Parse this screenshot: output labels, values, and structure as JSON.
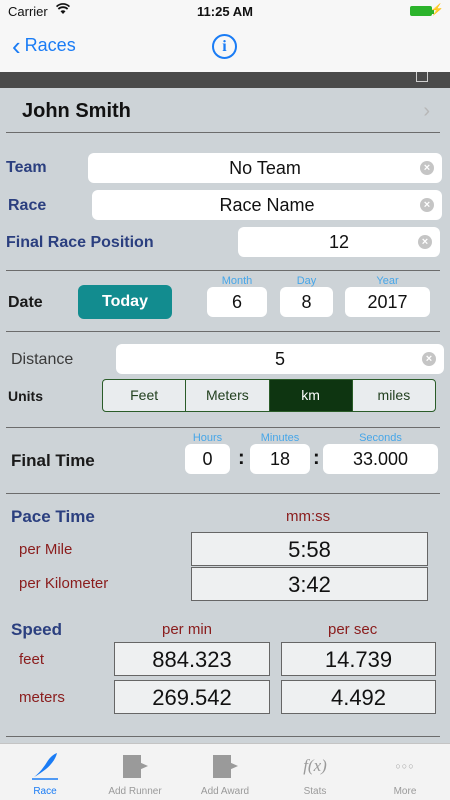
{
  "status_bar": {
    "carrier": "Carrier",
    "time": "11:25 AM"
  },
  "nav": {
    "back_label": "Races",
    "info_glyph": "i"
  },
  "runner": {
    "name": "John Smith",
    "arrow": "›"
  },
  "team": {
    "label": "Team",
    "value": "No Team"
  },
  "race": {
    "label": "Race",
    "value": "Race Name"
  },
  "position": {
    "label": "Final Race Position",
    "value": "12"
  },
  "date": {
    "label": "Date",
    "today_button": "Today",
    "month_label": "Month",
    "month": "6",
    "day_label": "Day",
    "day": "8",
    "year_label": "Year",
    "year": "2017"
  },
  "distance": {
    "label": "Distance",
    "value": "5"
  },
  "units": {
    "label": "Units",
    "options": [
      "Feet",
      "Meters",
      "km",
      "miles"
    ],
    "selected": "km"
  },
  "final_time": {
    "label": "Final Time",
    "hours_label": "Hours",
    "hours": "0",
    "minutes_label": "Minutes",
    "minutes": "18",
    "seconds_label": "Seconds",
    "seconds": "33.000"
  },
  "pace": {
    "label": "Pace Time",
    "format": "mm:ss",
    "per_mile_label": "per Mile",
    "per_mile": "5:58",
    "per_km_label": "per Kilometer",
    "per_km": "3:42"
  },
  "speed": {
    "label": "Speed",
    "per_min_label": "per min",
    "per_sec_label": "per sec",
    "feet_label": "feet",
    "feet_per_min": "884.323",
    "feet_per_sec": "14.739",
    "meters_label": "meters",
    "meters_per_min": "269.542",
    "meters_per_sec": "4.492"
  },
  "tabs": [
    {
      "label": "Race",
      "icon": "quill-icon",
      "active": true
    },
    {
      "label": "Add Runner",
      "icon": "add-runner-icon",
      "active": false
    },
    {
      "label": "Add Award",
      "icon": "add-award-icon",
      "active": false
    },
    {
      "label": "Stats",
      "icon": "function-icon",
      "glyph": "f(x)",
      "active": false
    },
    {
      "label": "More",
      "icon": "more-icon",
      "glyph": "○○○",
      "active": false
    }
  ],
  "colors": {
    "accent": "#1a7cf5",
    "today_button": "#128c8f",
    "selected_unit": "#0e3511",
    "label_blue": "#2b3f7f",
    "label_red": "#8a1c1c"
  }
}
